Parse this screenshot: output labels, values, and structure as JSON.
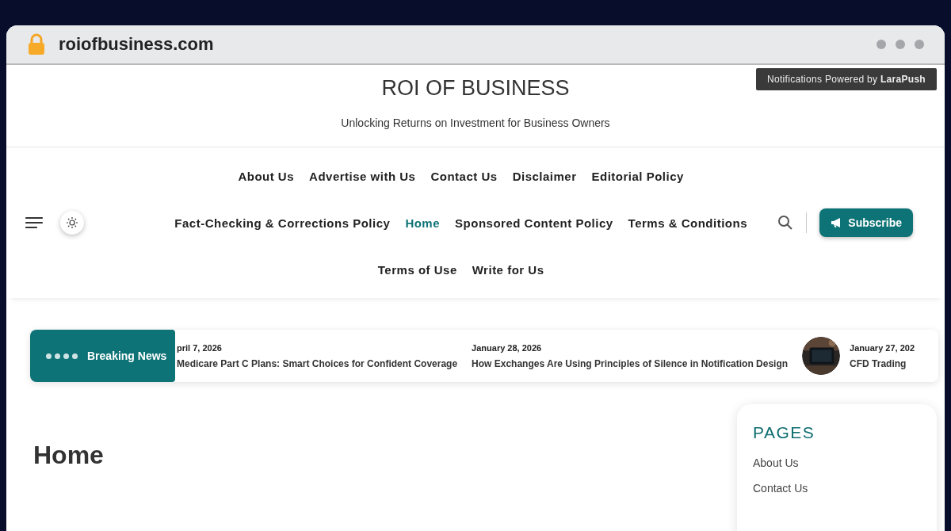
{
  "browser": {
    "url": "roiofbusiness.com"
  },
  "notification": "Notifications Powered by **LaraPush**",
  "site": {
    "title": "ROI OF BUSINESS",
    "tagline": "Unlocking Returns on Investment for Business Owners"
  },
  "menu_rows": [
    [
      {
        "label": "About Us",
        "selected": false
      },
      {
        "label": "Advertise with Us",
        "selected": false
      },
      {
        "label": "Contact Us",
        "selected": false
      },
      {
        "label": "Disclaimer",
        "selected": false
      },
      {
        "label": "Editorial Policy",
        "selected": false
      }
    ],
    [
      {
        "label": "Fact-Checking & Corrections Policy",
        "selected": false
      },
      {
        "label": "Home",
        "selected": true
      },
      {
        "label": "Sponsored Content Policy",
        "selected": false
      },
      {
        "label": "Terms & Conditions",
        "selected": false
      }
    ],
    [
      {
        "label": "Terms of Use",
        "selected": false
      },
      {
        "label": "Write for Us",
        "selected": false
      }
    ]
  ],
  "subscribe": "Subscribe",
  "breaking": {
    "label": "Breaking News",
    "items": [
      {
        "date": "pril 7, 2026",
        "title": "Medicare Part C Plans: Smart Choices for Confident Coverage",
        "thumbnail": false
      },
      {
        "date": "January 28, 2026",
        "title": "How Exchanges Are Using Principles of Silence in Notification Design",
        "thumbnail": false
      },
      {
        "date": "January 27, 202",
        "title": "CFD Trading",
        "thumbnail": true
      }
    ]
  },
  "page_heading": "Home",
  "sidebar": {
    "title": "PAGES",
    "links": [
      "About Us",
      "Contact Us"
    ]
  }
}
